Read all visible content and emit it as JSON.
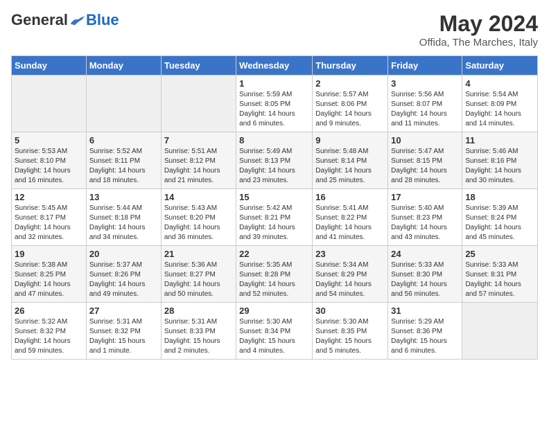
{
  "header": {
    "logo_general": "General",
    "logo_blue": "Blue",
    "month_year": "May 2024",
    "location": "Offida, The Marches, Italy"
  },
  "days_of_week": [
    "Sunday",
    "Monday",
    "Tuesday",
    "Wednesday",
    "Thursday",
    "Friday",
    "Saturday"
  ],
  "weeks": [
    [
      {
        "day": "",
        "info": ""
      },
      {
        "day": "",
        "info": ""
      },
      {
        "day": "",
        "info": ""
      },
      {
        "day": "1",
        "info": "Sunrise: 5:59 AM\nSunset: 8:05 PM\nDaylight: 14 hours\nand 6 minutes."
      },
      {
        "day": "2",
        "info": "Sunrise: 5:57 AM\nSunset: 8:06 PM\nDaylight: 14 hours\nand 9 minutes."
      },
      {
        "day": "3",
        "info": "Sunrise: 5:56 AM\nSunset: 8:07 PM\nDaylight: 14 hours\nand 11 minutes."
      },
      {
        "day": "4",
        "info": "Sunrise: 5:54 AM\nSunset: 8:09 PM\nDaylight: 14 hours\nand 14 minutes."
      }
    ],
    [
      {
        "day": "5",
        "info": "Sunrise: 5:53 AM\nSunset: 8:10 PM\nDaylight: 14 hours\nand 16 minutes."
      },
      {
        "day": "6",
        "info": "Sunrise: 5:52 AM\nSunset: 8:11 PM\nDaylight: 14 hours\nand 18 minutes."
      },
      {
        "day": "7",
        "info": "Sunrise: 5:51 AM\nSunset: 8:12 PM\nDaylight: 14 hours\nand 21 minutes."
      },
      {
        "day": "8",
        "info": "Sunrise: 5:49 AM\nSunset: 8:13 PM\nDaylight: 14 hours\nand 23 minutes."
      },
      {
        "day": "9",
        "info": "Sunrise: 5:48 AM\nSunset: 8:14 PM\nDaylight: 14 hours\nand 25 minutes."
      },
      {
        "day": "10",
        "info": "Sunrise: 5:47 AM\nSunset: 8:15 PM\nDaylight: 14 hours\nand 28 minutes."
      },
      {
        "day": "11",
        "info": "Sunrise: 5:46 AM\nSunset: 8:16 PM\nDaylight: 14 hours\nand 30 minutes."
      }
    ],
    [
      {
        "day": "12",
        "info": "Sunrise: 5:45 AM\nSunset: 8:17 PM\nDaylight: 14 hours\nand 32 minutes."
      },
      {
        "day": "13",
        "info": "Sunrise: 5:44 AM\nSunset: 8:18 PM\nDaylight: 14 hours\nand 34 minutes."
      },
      {
        "day": "14",
        "info": "Sunrise: 5:43 AM\nSunset: 8:20 PM\nDaylight: 14 hours\nand 36 minutes."
      },
      {
        "day": "15",
        "info": "Sunrise: 5:42 AM\nSunset: 8:21 PM\nDaylight: 14 hours\nand 39 minutes."
      },
      {
        "day": "16",
        "info": "Sunrise: 5:41 AM\nSunset: 8:22 PM\nDaylight: 14 hours\nand 41 minutes."
      },
      {
        "day": "17",
        "info": "Sunrise: 5:40 AM\nSunset: 8:23 PM\nDaylight: 14 hours\nand 43 minutes."
      },
      {
        "day": "18",
        "info": "Sunrise: 5:39 AM\nSunset: 8:24 PM\nDaylight: 14 hours\nand 45 minutes."
      }
    ],
    [
      {
        "day": "19",
        "info": "Sunrise: 5:38 AM\nSunset: 8:25 PM\nDaylight: 14 hours\nand 47 minutes."
      },
      {
        "day": "20",
        "info": "Sunrise: 5:37 AM\nSunset: 8:26 PM\nDaylight: 14 hours\nand 49 minutes."
      },
      {
        "day": "21",
        "info": "Sunrise: 5:36 AM\nSunset: 8:27 PM\nDaylight: 14 hours\nand 50 minutes."
      },
      {
        "day": "22",
        "info": "Sunrise: 5:35 AM\nSunset: 8:28 PM\nDaylight: 14 hours\nand 52 minutes."
      },
      {
        "day": "23",
        "info": "Sunrise: 5:34 AM\nSunset: 8:29 PM\nDaylight: 14 hours\nand 54 minutes."
      },
      {
        "day": "24",
        "info": "Sunrise: 5:33 AM\nSunset: 8:30 PM\nDaylight: 14 hours\nand 56 minutes."
      },
      {
        "day": "25",
        "info": "Sunrise: 5:33 AM\nSunset: 8:31 PM\nDaylight: 14 hours\nand 57 minutes."
      }
    ],
    [
      {
        "day": "26",
        "info": "Sunrise: 5:32 AM\nSunset: 8:32 PM\nDaylight: 14 hours\nand 59 minutes."
      },
      {
        "day": "27",
        "info": "Sunrise: 5:31 AM\nSunset: 8:32 PM\nDaylight: 15 hours\nand 1 minute."
      },
      {
        "day": "28",
        "info": "Sunrise: 5:31 AM\nSunset: 8:33 PM\nDaylight: 15 hours\nand 2 minutes."
      },
      {
        "day": "29",
        "info": "Sunrise: 5:30 AM\nSunset: 8:34 PM\nDaylight: 15 hours\nand 4 minutes."
      },
      {
        "day": "30",
        "info": "Sunrise: 5:30 AM\nSunset: 8:35 PM\nDaylight: 15 hours\nand 5 minutes."
      },
      {
        "day": "31",
        "info": "Sunrise: 5:29 AM\nSunset: 8:36 PM\nDaylight: 15 hours\nand 6 minutes."
      },
      {
        "day": "",
        "info": ""
      }
    ]
  ]
}
